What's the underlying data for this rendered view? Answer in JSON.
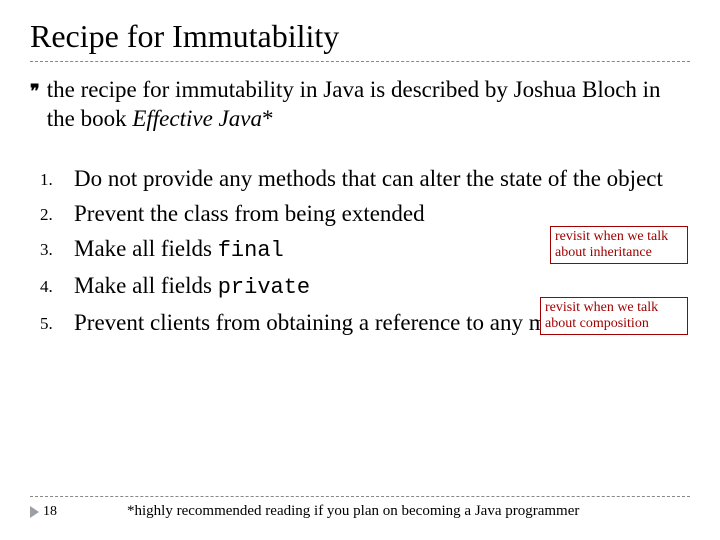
{
  "title": "Recipe for Immutability",
  "intro": {
    "bullet_glyph": "❞",
    "text_prefix": "the recipe for immutability in Java is described by Joshua Bloch in the book ",
    "book_title": "Effective Java",
    "asterisk": "*"
  },
  "items": [
    {
      "num": "1.",
      "text": "Do not provide any methods that can alter the state of the object"
    },
    {
      "num": "2.",
      "text": "Prevent the class from being extended"
    },
    {
      "num": "3.",
      "text_prefix": "Make all fields ",
      "code": "final"
    },
    {
      "num": "4.",
      "text_prefix": "Make all fields ",
      "code": "private"
    },
    {
      "num": "5.",
      "text": "Prevent clients from obtaining a reference to any mutable fields"
    }
  ],
  "callouts": {
    "c1": "revisit when we talk about inheritance",
    "c2": "revisit when we talk about composition"
  },
  "footer": {
    "page": "18",
    "footnote": "*highly recommended reading if you plan on becoming a Java programmer"
  }
}
